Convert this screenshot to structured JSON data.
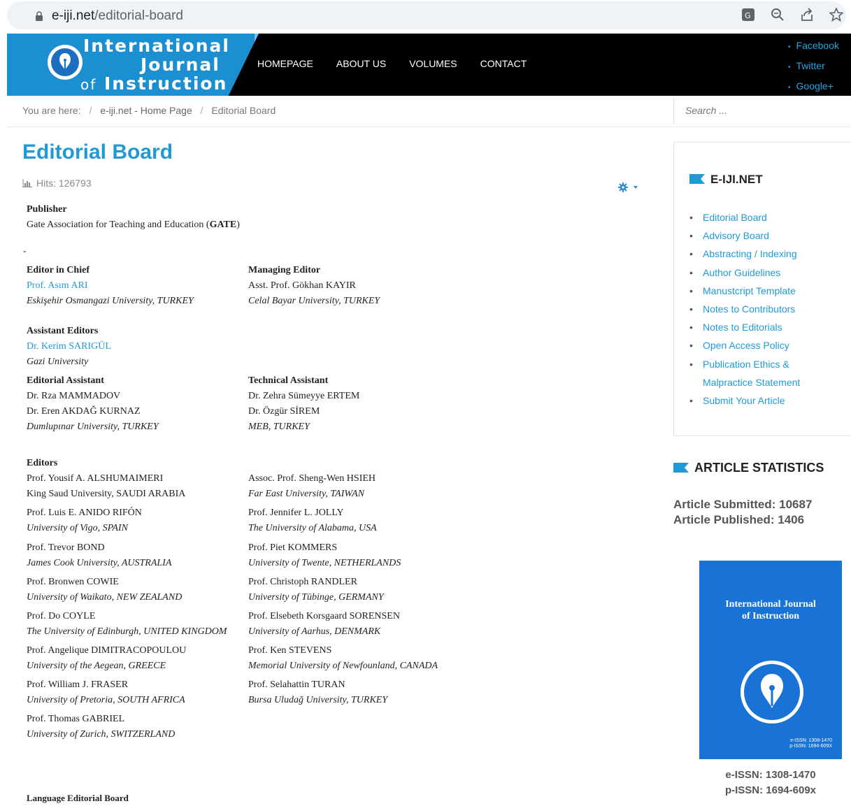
{
  "browser": {
    "url_host": "e-iji.net",
    "url_path": "/editorial-board"
  },
  "header": {
    "logo_line1": "International",
    "logo_line2": "Journal",
    "logo_of": "of",
    "logo_line3": "Instruction",
    "nav": [
      "HOMEPAGE",
      "ABOUT US",
      "VOLUMES",
      "CONTACT"
    ],
    "social": [
      "Facebook",
      "Twitter",
      "Google+"
    ]
  },
  "breadcrumb": {
    "prefix": "You are here:",
    "home": "e-iji.net - Home Page",
    "current": "Editorial Board"
  },
  "search": {
    "placeholder": "Search ..."
  },
  "page": {
    "title": "Editorial Board",
    "hits": "Hits: 126793"
  },
  "board": {
    "publisher_h": "Publisher",
    "publisher_pre": "Gate Association for Teaching and Education (",
    "publisher_bold": "GATE",
    "publisher_post": ")",
    "dash": "-",
    "eic_h": "Editor in Chief",
    "eic_name": "Prof. Asım ARI",
    "eic_aff": "Eskişehir Osmangazi University, TURKEY",
    "me_h": "Managing Editor",
    "me_name": "Asst. Prof. Gökhan KAYIR",
    "me_aff": "Celal Bayar University, TURKEY",
    "ae_h": "Assistant Editors",
    "ae_name": "Dr. Kerim SARIGÜL",
    "ae_aff": "Gazi University",
    "edas_h": "Editorial Assistant",
    "edas_1": "Dr. Rza MAMMADOV",
    "edas_2": "Dr. Eren AKDAĞ KURNAZ",
    "edas_aff": "Dumlupınar University, TURKEY",
    "tech_h": "Technical Assistant",
    "tech_1": "Dr. Zehra Sümeyye ERTEM",
    "tech_2": "Dr. Özgür SİREM",
    "tech_aff": "MEB, TURKEY",
    "editors_h": "Editors",
    "left": [
      {
        "name": "Prof. Yousif A. ALSHUMAIMERI",
        "aff": "King Saud University, SAUDI ARABIA"
      },
      {
        "name": "Prof. Luis E. ANIDO RIFÓN",
        "aff": "University of Vigo, SPAIN"
      },
      {
        "name": "Prof. Trevor BOND",
        "aff": "James Cook University,  AUSTRALIA"
      },
      {
        "name": "Prof. Bronwen COWIE",
        "aff": "University of Waikato, NEW ZEALAND"
      },
      {
        "name": "Prof. Do COYLE",
        "aff": "The University of Edinburgh, UNITED KINGDOM"
      },
      {
        "name": "Prof. Angelique DIMITRACOPOULOU",
        "aff": "University of the Aegean, GREECE"
      },
      {
        "name": "Prof. William J. FRASER",
        "aff": "University of Pretoria, SOUTH AFRICA"
      },
      {
        "name": "Prof. Thomas GABRIEL",
        "aff": "University of Zurich, SWITZERLAND"
      }
    ],
    "right": [
      {
        "name": "Assoc. Prof. Sheng-Wen HSIEH",
        "aff": "Far East University, TAIWAN"
      },
      {
        "name": "Prof. Jennifer L. JOLLY",
        "aff": "The University of Alabama, USA"
      },
      {
        "name": "Prof. Piet KOMMERS",
        "aff": "University of Twente, NETHERLANDS"
      },
      {
        "name": "Prof. Christoph RANDLER",
        "aff": "University of Tübinge, GERMANY"
      },
      {
        "name": "Prof. Elsebeth Korsgaard SORENSEN",
        "aff": "University of Aarhus, DENMARK"
      },
      {
        "name": "Prof. Ken STEVENS",
        "aff": "Memorial University of Newfounland, CANADA"
      },
      {
        "name": "Prof. Selahattin TURAN",
        "aff": "Bursa Uludağ University, TURKEY"
      }
    ],
    "lang_h": "Language Editorial Board"
  },
  "sidebar": {
    "menu_title": "E-IJI.NET",
    "items": [
      "Editorial Board",
      "Advisory Board",
      "Abstracting / Indexing",
      "Author Guidelines",
      "Manustcript Template",
      "Notes to Contributors",
      "Notes to Editorials",
      "Open Access Policy",
      "Publication Ethics &",
      "Malpractice Statement",
      "Submit Your Article"
    ],
    "stats_title": "ARTICLE STATISTICS",
    "submitted": "Article Submitted: 10687",
    "published": "Article Published: 1406",
    "cover_t1": "International Journal",
    "cover_t2": "of Instruction",
    "cover_issn1": "e-ISSN: 1308-1470",
    "cover_issn2": "p-ISSN: 1694-609X",
    "eissn": "e-ISSN: 1308-1470",
    "pissn": "p-ISSN: 1694-609x"
  },
  "colors": {
    "brand": "#1f9ad6",
    "header_bg": "#000000",
    "cover_bg": "#1973d6"
  },
  "icons": [
    "lock-icon",
    "translate-icon",
    "zoom-icon",
    "share-icon",
    "star-icon",
    "stats-icon",
    "gear-icon",
    "flag-icon"
  ]
}
